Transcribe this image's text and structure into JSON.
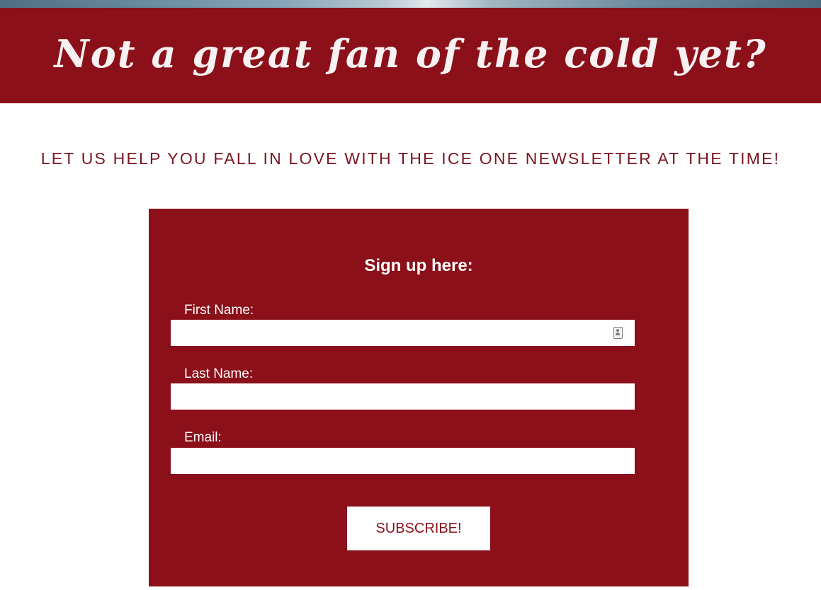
{
  "colors": {
    "brand_red": "#8b101a",
    "subhead_red": "#7a1520",
    "white": "#ffffff"
  },
  "banner": {
    "title": "Not a great fan of the cold yet?"
  },
  "intro": {
    "text": "LET US HELP YOU FALL IN LOVE WITH THE ICE ONE NEWSLETTER AT THE TIME!"
  },
  "form": {
    "heading": "Sign up here:",
    "fields": [
      {
        "label": "First Name:",
        "value": "",
        "placeholder": ""
      },
      {
        "label": "Last Name:",
        "value": "",
        "placeholder": ""
      },
      {
        "label": "Email:",
        "value": "",
        "placeholder": ""
      }
    ],
    "submit_label": "SUBSCRIBE!",
    "autofill_icon": "contact-card-icon"
  }
}
